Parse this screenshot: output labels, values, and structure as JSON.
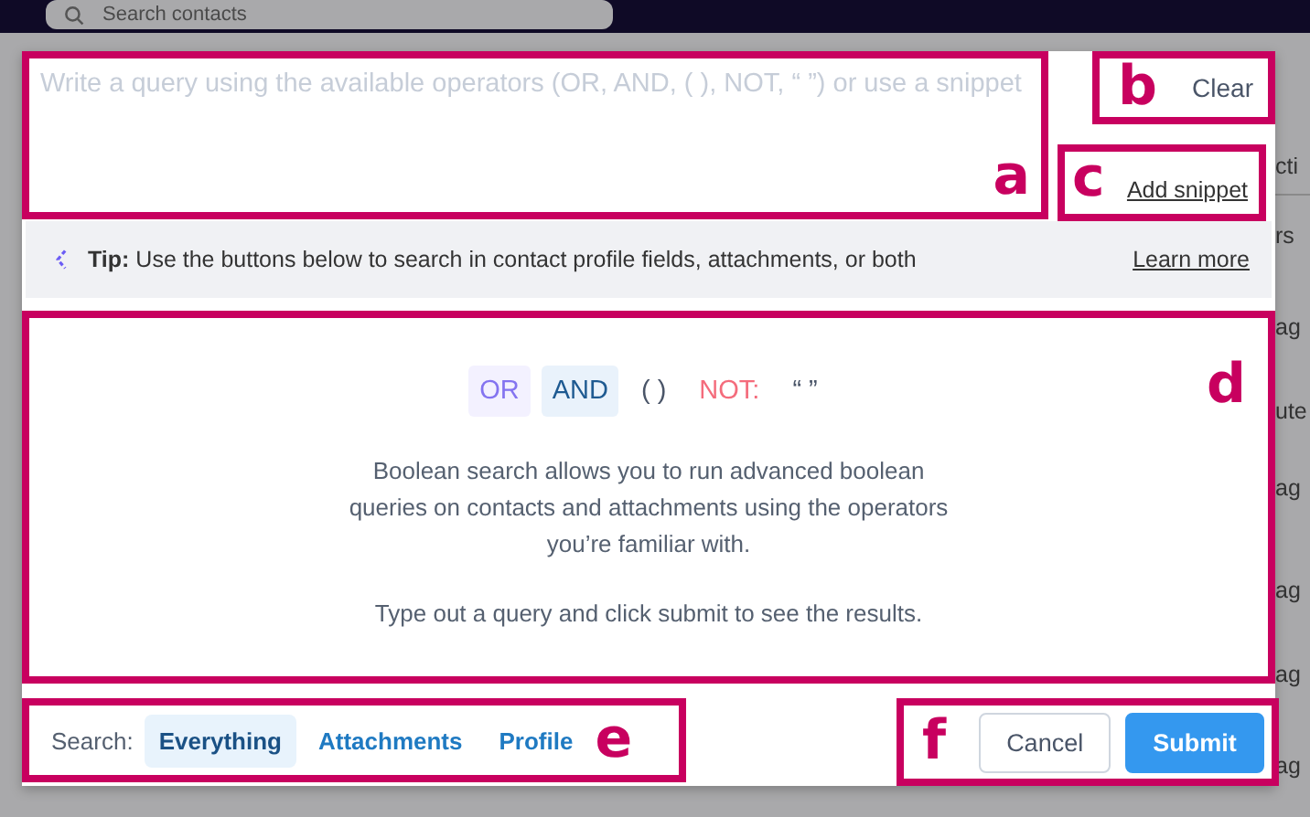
{
  "background": {
    "search_placeholder": "Search contacts",
    "side_texts": [
      "cti",
      "rs",
      "ag",
      "ute",
      "ag",
      "ag",
      "ag",
      "ag"
    ]
  },
  "query": {
    "placeholder": "Write a query using the available operators (OR, AND, ( ), NOT, “ ”) or use a snippet",
    "annotation": "a"
  },
  "clear": {
    "label": "Clear",
    "annotation": "b"
  },
  "add_snippet": {
    "label": "Add snippet",
    "annotation": "c"
  },
  "tip": {
    "text": "**Tip:** Use the buttons below to search in contact profile fields, attachments, or both",
    "link": "Learn more"
  },
  "info": {
    "annotation": "d",
    "operators": [
      {
        "label": "OR",
        "kind": "or"
      },
      {
        "label": "AND",
        "kind": "and"
      },
      {
        "label": "( )",
        "kind": "paren"
      },
      {
        "label": "NOT:",
        "kind": "not"
      },
      {
        "label": "“ ”",
        "kind": "quote"
      }
    ],
    "description_lines": [
      "Boolean search allows you to run advanced boolean",
      "queries on contacts and attachments using the operators",
      "you’re familiar with."
    ],
    "hint": "Type out a query and click submit to see the results."
  },
  "scope": {
    "annotation": "e",
    "label": "Search:",
    "options": [
      {
        "label": "Everything",
        "selected": true
      },
      {
        "label": "Attachments",
        "selected": false
      },
      {
        "label": "Profile",
        "selected": false
      }
    ]
  },
  "actions": {
    "annotation": "f",
    "buttons": [
      {
        "label": "Cancel",
        "kind": "secondary"
      },
      {
        "label": "Submit",
        "kind": "primary"
      }
    ]
  }
}
